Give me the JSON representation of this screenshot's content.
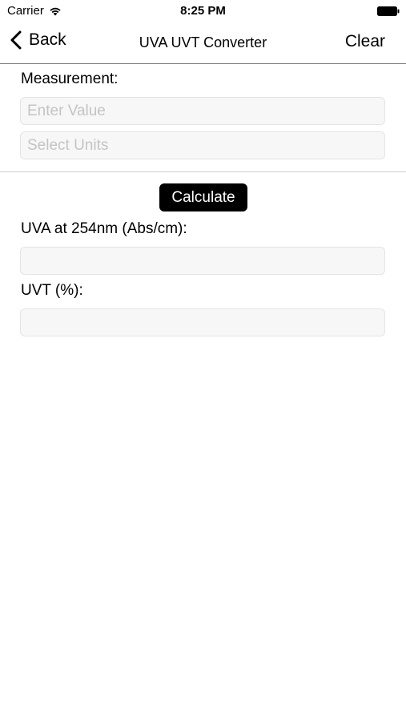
{
  "status_bar": {
    "carrier": "Carrier",
    "time": "8:25 PM"
  },
  "nav": {
    "back_label": "Back",
    "title": "UVA UVT Converter",
    "clear_label": "Clear"
  },
  "measurement": {
    "label": "Measurement:",
    "value": "",
    "value_placeholder": "Enter Value",
    "units_placeholder": "Select Units"
  },
  "actions": {
    "calculate_label": "Calculate"
  },
  "results": {
    "uva_label": "UVA at 254nm (Abs/cm):",
    "uva_value": "",
    "uvt_label": "UVT (%):",
    "uvt_value": ""
  },
  "colors": {
    "button_bg": "#000000",
    "field_bg": "#f7f7f7",
    "placeholder": "#c4c4c4"
  }
}
